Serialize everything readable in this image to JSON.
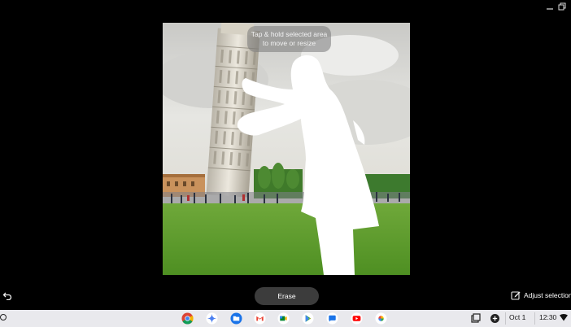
{
  "editor": {
    "tooltip_line1": "Tap & hold selected area",
    "tooltip_line2": "to move or resize",
    "erase_label": "Erase",
    "adjust_label": "Adjust selection"
  },
  "shelf": {
    "apps": [
      "chrome-icon",
      "gemini-icon",
      "files-icon",
      "gmail-icon",
      "meet-icon",
      "play-store-icon",
      "messages-icon",
      "youtube-icon",
      "photos-icon"
    ],
    "date": "Oct 1",
    "time": "12:30"
  },
  "colors": {
    "background": "#000000",
    "shelf": "#e9e9ed",
    "erase_button": "#3c3c3c"
  }
}
